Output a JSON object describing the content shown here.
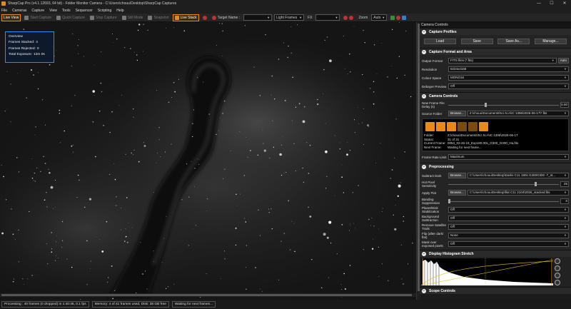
{
  "window": {
    "title": "SharpCap Pro (v4.1.12693, 64 bit) - Folder Monitor Camera - C:\\Users\\chouu\\Desktop\\SharpCap Captures",
    "minimize": "—",
    "maximize": "☐",
    "close": "✕"
  },
  "menu": [
    "File",
    "Cameras",
    "Capture",
    "View",
    "Tools",
    "Sequencer",
    "Scripting",
    "Help"
  ],
  "toolbar": {
    "live_view": "Live View",
    "start_capture": "Start Capture",
    "quick_capture": "Quick Capture",
    "stop_capture": "Stop Capture",
    "still_mode": "Still Mode",
    "snapshot": "Snapshot",
    "live_stack": "Live Stack",
    "target_name_label": "Target Name :",
    "target_name_value": "",
    "frames_select": "Light Frames",
    "fx_label": "FX",
    "fx_value": "",
    "zoom_label": "Zoom",
    "zoom_value": "Auto"
  },
  "overview": {
    "title": "Overview",
    "frames_stacked_label": "Frames Stacked:",
    "frames_stacked": "4",
    "frames_rejected_label": "Frames Rejected:",
    "frames_rejected": "0",
    "total_exposure_label": "Total Exposure:",
    "total_exposure": "12m 0s"
  },
  "panel": {
    "title": "Camera Controls",
    "capture_profiles": {
      "header": "Capture Profiles",
      "load": "Load",
      "save": "Save",
      "save_as": "Save As...",
      "manage": "Manage..."
    },
    "capture_format": {
      "header": "Capture Format and Area",
      "output_format_label": "Output Format",
      "output_format": "FITS files (*.fits)",
      "auto_label": "Auto",
      "resolution_label": "Resolution",
      "resolution": "6224x4168",
      "colour_space_label": "Colour Space",
      "colour_space": "MONO16",
      "debayer_label": "Debayer Preview",
      "debayer": "Off"
    },
    "camera_controls": {
      "header": "Camera Controls",
      "new_frame_delay_label": "New Frame File Delay (s)",
      "new_frame_delay": "5.50",
      "source_folder_label": "Source Folder",
      "browse": "Browse...",
      "source_folder": "Z:\\chouu\\Documents\\N.I.N.A\\IC 1396\\2026-06-17\\*.fits",
      "folder_label": "Folder:",
      "folder": "Z:\\chouu\\Documents\\N.I.N.A\\IC 1396\\2026-06-17",
      "status_label": "Status:",
      "status": "31 of 31",
      "current_frame_label": "Current Frame:",
      "current_frame": "0053_02-26-19_Exp180.00s_G300_O300_Ha.fits",
      "next_frame_label": "Next Frame:",
      "next_frame": "Waiting for next frame...",
      "frame_rate_label": "Frame Rate Limit",
      "frame_rate": "Maximum"
    },
    "preprocessing": {
      "header": "Preprocessing",
      "subtract_dark_label": "Subtract Dark",
      "browse": "Browse...",
      "subtract_dark": "C:\\Users\\chouu\\Desktop\\Darks C11 180s G300O300 -7_st...",
      "hot_pixel_label": "Hot Pixel Sensitivity",
      "hot_pixel": "25",
      "apply_flat_label": "Apply Flat",
      "apply_flat": "C:\\Users\\chouu\\Desktop\\flat C11 2104\\2026_stacked.fits",
      "banding_label": "Banding Suppression",
      "banding": "0",
      "planet_label": "Planet/Disk Stabilization",
      "planet": "Off",
      "background_label": "Background Subtraction",
      "background": "Off",
      "satellite_label": "Remove Satellite Trails",
      "satellite": "Off",
      "flip_label": "Flip (after dark/ flat)",
      "flip": "None",
      "mask_label": "Mask over exposed pixels",
      "mask": "Off"
    },
    "histogram": {
      "header": "Display Histogram Stretch"
    },
    "scope": {
      "header": "Scope Controls"
    }
  },
  "status": {
    "processing": "Processing : 40 frames (0 dropped) in 1:40:46, 0.1 fps",
    "memory": "Memory: 4 of 41 frames used, Disk: 38 GB free",
    "waiting": "Waiting for next frames..."
  },
  "colors": {
    "accent": "#e8891a",
    "overview_border": "#2b8ee8"
  },
  "icons": [
    "app-icon",
    "minimize-icon",
    "maximize-icon",
    "close-icon",
    "play-icon",
    "stop-icon",
    "camera-icon",
    "record-icon",
    "zoom-icon",
    "first-icon",
    "previous-icon",
    "pause-icon",
    "repeat-icon",
    "next-icon",
    "last-icon"
  ]
}
